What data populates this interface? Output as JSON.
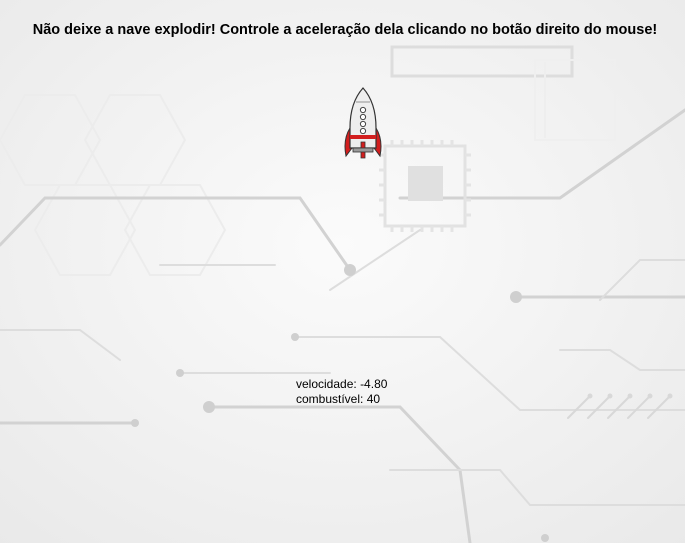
{
  "game": {
    "instruction": "Não deixe a nave explodir! Controle a aceleração dela clicando no botão direito do mouse!",
    "stats": {
      "velocity_label": "velocidade:",
      "velocity_value": "-4.80",
      "fuel_label": "combustível:",
      "fuel_value": "40"
    },
    "ship": {
      "icon": "rocket-icon",
      "colors": {
        "body": "#eeeeee",
        "fins": "#d21e1e",
        "outline": "#333333"
      }
    },
    "background": {
      "icon": "circuit-board-background",
      "colors": {
        "base": "#f4f4f4",
        "traces": "#cfcfcf"
      }
    }
  }
}
